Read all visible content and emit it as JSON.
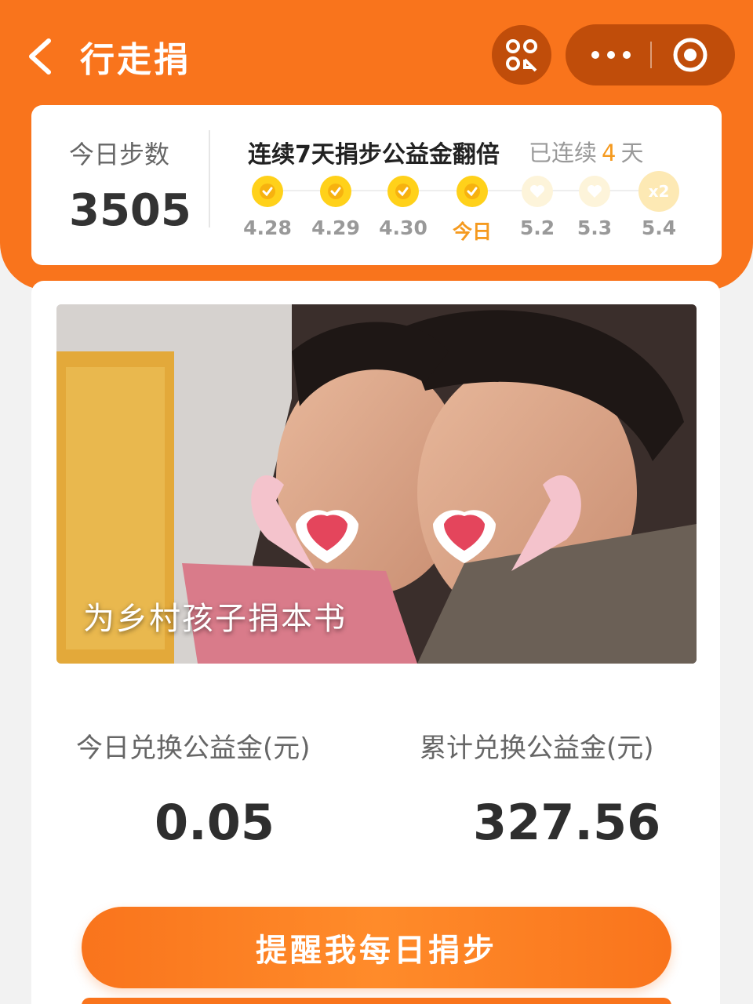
{
  "header": {
    "title": "行走捐",
    "accent_color": "#f9741c"
  },
  "steps_card": {
    "label": "今日步数",
    "value": "3505",
    "streak_title": "连续7天捐步公益金翻倍",
    "streak_prefix": "已连续",
    "streak_days": "4",
    "streak_suffix": "天",
    "days": [
      {
        "label": "4.28",
        "state": "done"
      },
      {
        "label": "4.29",
        "state": "done"
      },
      {
        "label": "4.30",
        "state": "done"
      },
      {
        "label": "今日",
        "state": "done-today"
      },
      {
        "label": "5.2",
        "state": "future"
      },
      {
        "label": "5.3",
        "state": "future"
      },
      {
        "label": "5.4",
        "state": "bonus",
        "badge": "x2"
      }
    ]
  },
  "banner": {
    "caption": "为乡村孩子捐本书"
  },
  "stats": {
    "today_label": "今日兑换公益金(元)",
    "today_value": "0.05",
    "total_label": "累计兑换公益金(元)",
    "total_value": "327.56"
  },
  "actions": {
    "remind_label": "提醒我每日捐步"
  }
}
